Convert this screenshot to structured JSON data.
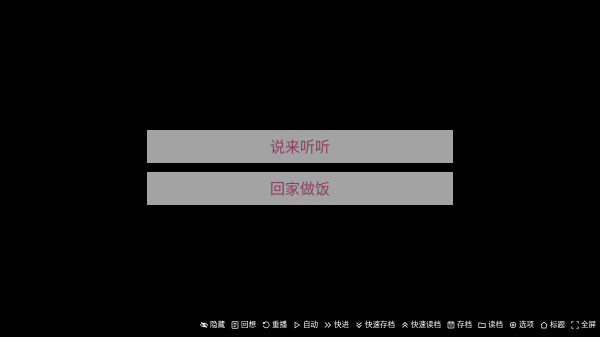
{
  "choices": [
    {
      "label": "说来听听"
    },
    {
      "label": "回家做饭"
    }
  ],
  "quick_menu": [
    {
      "label": "隐藏",
      "icon": "eye-off-icon"
    },
    {
      "label": "回想",
      "icon": "book-icon"
    },
    {
      "label": "重播",
      "icon": "replay-icon"
    },
    {
      "label": "自动",
      "icon": "play-icon"
    },
    {
      "label": "快进",
      "icon": "fast-forward-icon"
    },
    {
      "label": "快速存档",
      "icon": "double-chevron-down-icon"
    },
    {
      "label": "快速读档",
      "icon": "double-chevron-up-icon"
    },
    {
      "label": "存档",
      "icon": "save-icon"
    },
    {
      "label": "读档",
      "icon": "folder-icon"
    },
    {
      "label": "选项",
      "icon": "gear-icon"
    },
    {
      "label": "标题",
      "icon": "home-icon"
    },
    {
      "label": "全屏",
      "icon": "fullscreen-icon"
    }
  ],
  "colors": {
    "background": "#000000",
    "choice_bg": "#a3a3a3",
    "choice_text": "#8c3f5e",
    "menu_text": "#ffffff"
  }
}
